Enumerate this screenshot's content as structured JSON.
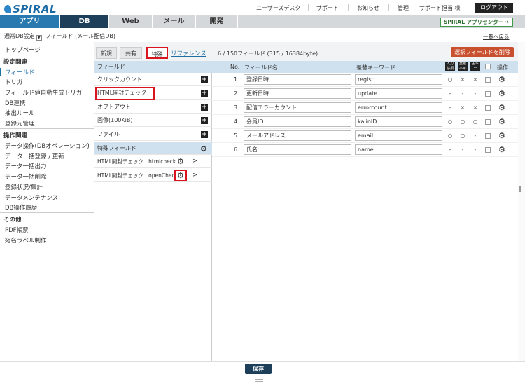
{
  "header": {
    "logo": "SPIRAL",
    "links": [
      "ユーザーズデスク",
      "サポート",
      "お知らせ",
      "管理",
      "サポート担当 様"
    ],
    "logout": "ログアウト"
  },
  "tabs": [
    "アプリ",
    "DB",
    "Web",
    "メール",
    "開発"
  ],
  "app_center": "SPIRAL アプリセンター",
  "subheader": {
    "db_setting": "通常DB設定",
    "title": "フィールド (メール配信DB)",
    "back_link": "一覧へ戻る"
  },
  "sidebar": {
    "top": "トップページ",
    "sections": [
      {
        "title": "設定関連",
        "items": [
          "フィールド",
          "トリガ",
          "フィールド値自動生成トリガ",
          "DB連携",
          "抽出ルール",
          "登録元管理"
        ]
      },
      {
        "title": "操作関連",
        "items": [
          "データ操作(DBオペレーション)",
          "データ一括登録 / 更新",
          "データ一括出力",
          "データ一括削除",
          "登録状況/集計",
          "データメンテナンス",
          "DB操作履歴"
        ]
      },
      {
        "title": "その他",
        "items": [
          "PDF帳票",
          "宛名ラベル制作"
        ]
      }
    ]
  },
  "subtabs": {
    "new": "新規",
    "shared": "共有",
    "special": "特殊",
    "reference": "リファレンス"
  },
  "field_count": "6 / 150フィールド (315 / 16384byte)",
  "delete_button": "選択フィールドを削除",
  "left_panel": {
    "header": "フィールド",
    "items": [
      "クリックカウント",
      "HTML開封チェック",
      "オプトアウト",
      "画像(100KiB)",
      "ファイル"
    ],
    "special_header": "特殊フィールド",
    "special_items": [
      "HTML開封チェック : htmlcheck",
      "HTML開封チェック : openChec"
    ]
  },
  "table": {
    "headers": {
      "no": "No.",
      "field_name": "フィールド名",
      "keyword": "差替キーワード",
      "op": "操作"
    },
    "icons": [
      "入力必須",
      "重複不可",
      "主キー"
    ],
    "rows": [
      {
        "no": "1",
        "name": "登録日時",
        "keyword": "regist",
        "marks": [
          "○",
          "×",
          "×"
        ]
      },
      {
        "no": "2",
        "name": "更新日時",
        "keyword": "update",
        "marks": [
          "-",
          "-",
          "-"
        ]
      },
      {
        "no": "3",
        "name": "配信エラーカウント",
        "keyword": "errorcount",
        "marks": [
          "-",
          "×",
          "×"
        ]
      },
      {
        "no": "4",
        "name": "会員ID",
        "keyword": "kaiinID",
        "marks": [
          "○",
          "○",
          "○"
        ]
      },
      {
        "no": "5",
        "name": "メールアドレス",
        "keyword": "email",
        "marks": [
          "○",
          "○",
          "-"
        ]
      },
      {
        "no": "6",
        "name": "氏名",
        "keyword": "name",
        "marks": [
          "-",
          "-",
          "-"
        ]
      }
    ]
  },
  "save_button": "保存"
}
